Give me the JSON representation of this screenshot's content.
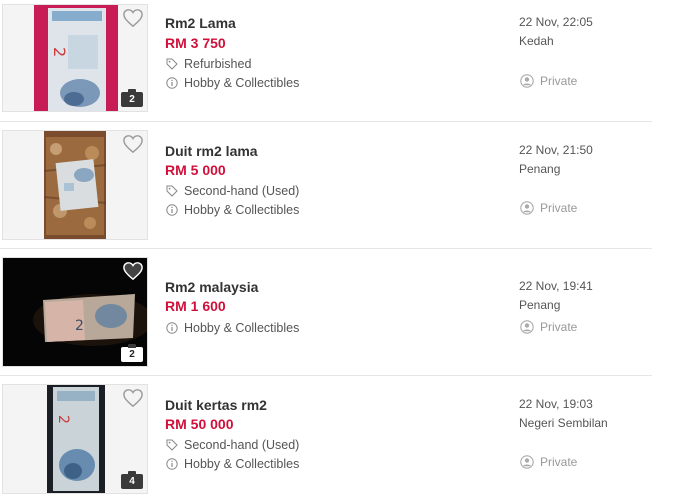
{
  "colors": {
    "price": "#d0103a",
    "heart": "#9b9b9b",
    "badge": "#3a3a3a",
    "divider": "#e6e6e6"
  },
  "listings": [
    {
      "title": "Rm2 Lama",
      "price": "RM 3 750",
      "condition": "Refurbished",
      "category": "Hobby & Collectibles",
      "date": "22 Nov, 22:05",
      "location": "Kedah",
      "seller_type": "Private",
      "photo_count": "2",
      "photo_desc": "banknote-on-pink-background"
    },
    {
      "title": "Duit rm2 lama",
      "price": "RM 5 000",
      "condition": "Second-hand (Used)",
      "category": "Hobby & Collectibles",
      "date": "22 Nov, 21:50",
      "location": "Penang",
      "seller_type": "Private",
      "photo_desc": "banknote-on-patterned-carpet"
    },
    {
      "title": "Rm2 malaysia",
      "price": "RM 1 600",
      "category": "Hobby & Collectibles",
      "date": "22 Nov, 19:41",
      "location": "Penang",
      "seller_type": "Private",
      "photo_count": "2",
      "photo_desc": "banknote-on-dark-background"
    },
    {
      "title": "Duit kertas rm2",
      "price": "RM 50 000",
      "condition": "Second-hand (Used)",
      "category": "Hobby & Collectibles",
      "date": "22 Nov, 19:03",
      "location": "Negeri Sembilan",
      "seller_type": "Private",
      "photo_count": "4",
      "photo_desc": "banknote-on-dark-background"
    }
  ],
  "icons": {
    "favorite": "heart-outline-icon",
    "condition": "tag-icon",
    "category": "info-circle-icon",
    "seller": "user-circle-icon",
    "photos": "camera-icon"
  }
}
